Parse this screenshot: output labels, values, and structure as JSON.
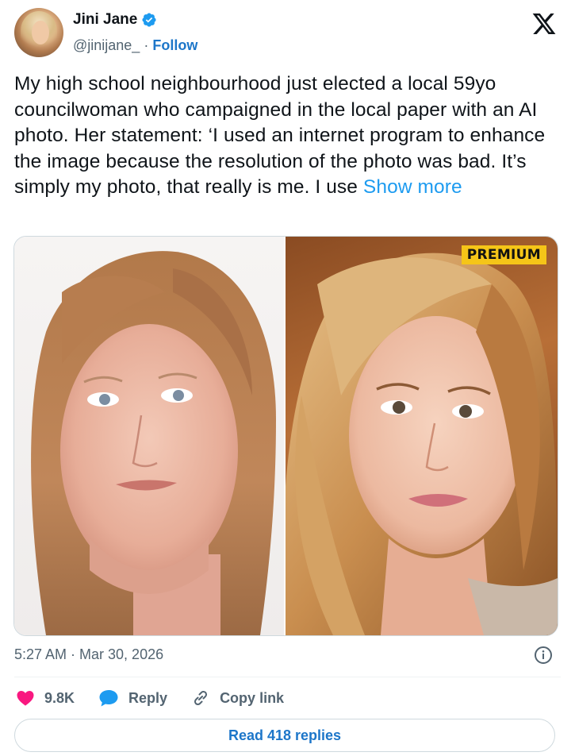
{
  "author": {
    "name": "Jini Jane",
    "handle": "@jinijane_",
    "separator": "·",
    "follow_label": "Follow"
  },
  "tweet": {
    "text": "My high school neighbourhood just elected a local 59yo councilwoman who campaigned in the local paper with an AI photo. Her statement: ‘I used an internet program to enhance the image because the resolution of the photo was bad. It’s simply my photo, that really is me. I use ",
    "show_more_label": "Show more"
  },
  "media": {
    "badge": "PREMIUM"
  },
  "meta": {
    "timestamp": "5:27 AM · Mar 30, 2026"
  },
  "actions": {
    "likes": "9.8K",
    "reply_label": "Reply",
    "copy_link_label": "Copy link"
  },
  "read_replies_label": "Read 418 replies",
  "colors": {
    "accent": "#1d9bf0",
    "link": "#1d76c9",
    "like": "#f91880",
    "reply": "#1d9bf0",
    "premium_badge": "#f5c518"
  },
  "icons": [
    "verified-badge-icon",
    "x-logo-icon",
    "info-icon",
    "heart-icon",
    "reply-bubble-icon",
    "link-icon"
  ]
}
